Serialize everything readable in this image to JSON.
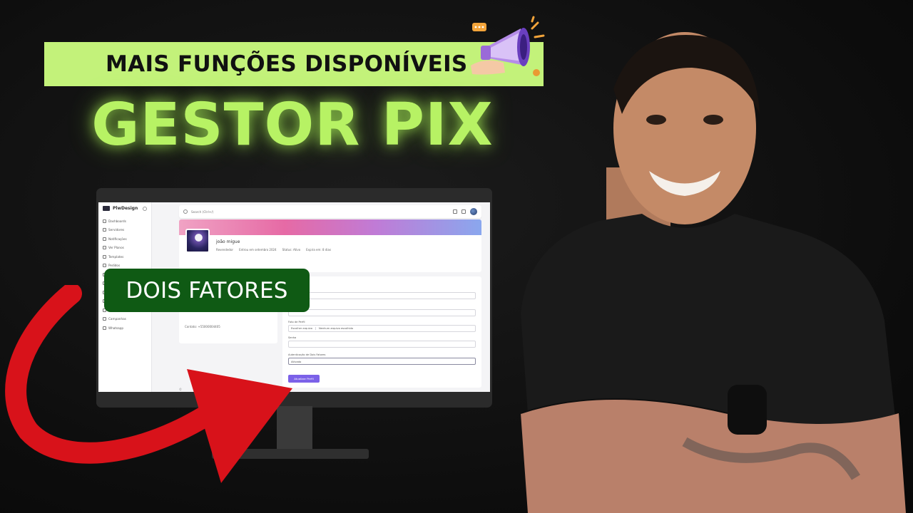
{
  "banner": {
    "text": "MAIS FUNÇÕES DISPONÍVEIS"
  },
  "headline": "GESTOR PIX",
  "callout": "DOIS FATORES",
  "colors": {
    "accent_green": "#b7f264",
    "banner_bg": "#c3f27a",
    "callout_bg": "#0f5a14",
    "arrow_red": "#d8121a",
    "button_purple": "#7b61e8"
  },
  "icons": {
    "megaphone": "megaphone-icon",
    "arrow": "red-curved-arrow-icon"
  },
  "app": {
    "brand": "PlwDesign",
    "sidebar": {
      "items": [
        {
          "label": "Dashboards",
          "icon": "home-icon"
        },
        {
          "label": "Servidores",
          "icon": "server-icon"
        },
        {
          "label": "Notificações",
          "icon": "bell-icon"
        },
        {
          "label": "Ver Planos",
          "icon": "plans-icon"
        },
        {
          "label": "Templates",
          "icon": "template-icon"
        },
        {
          "label": "Pedidos",
          "icon": "orders-icon"
        },
        {
          "label": "",
          "icon": "item-icon"
        },
        {
          "label": "",
          "icon": "item-icon"
        },
        {
          "label": "",
          "icon": "item-icon"
        },
        {
          "label": "",
          "icon": "item-icon"
        },
        {
          "label": "",
          "icon": "item-icon"
        },
        {
          "label": "Campanhas",
          "icon": "megaphone-icon"
        },
        {
          "label": "Whatsapp",
          "icon": "whatsapp-icon"
        }
      ]
    },
    "search": {
      "placeholder": "Search (Ctrl+/)"
    },
    "profile": {
      "name": "joão migue",
      "meta": [
        "Revendedor",
        "Entrou em setembro 2024",
        "Status: Ativo",
        "Expira em: 8 dias"
      ]
    },
    "contact": "Contato: +55000004405",
    "form": {
      "file_label": "Foto de Perfil",
      "file_button": "Escolher arquivo",
      "file_status": "Nenhum arquivo escolhido",
      "password_label": "Senha",
      "two_factor_label": "Autenticação de Dois Fatores",
      "two_factor_value": "Ativado",
      "submit": "Atualizar Perfil"
    }
  }
}
